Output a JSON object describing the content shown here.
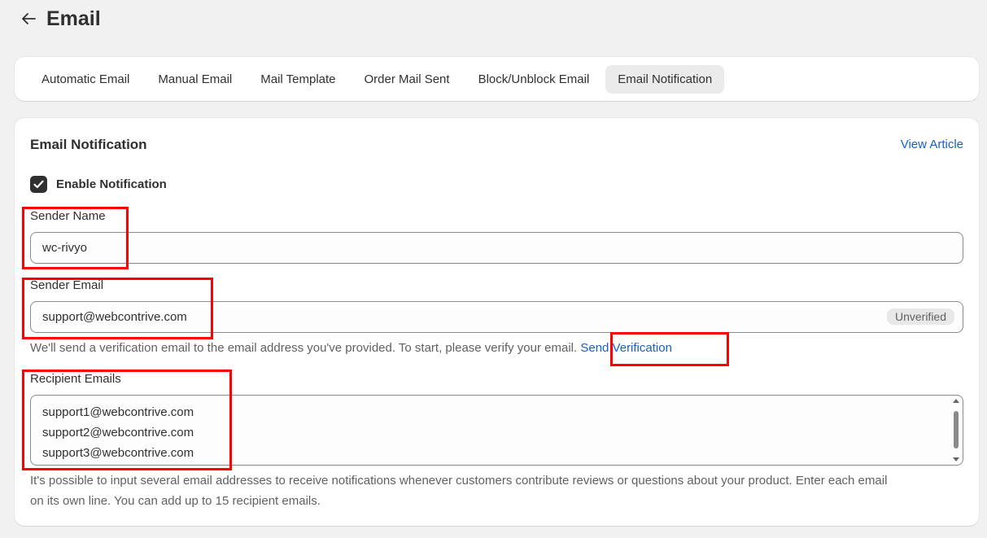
{
  "header": {
    "title": "Email"
  },
  "tabs": [
    {
      "label": "Automatic Email",
      "active": false
    },
    {
      "label": "Manual Email",
      "active": false
    },
    {
      "label": "Mail Template",
      "active": false
    },
    {
      "label": "Order Mail Sent",
      "active": false
    },
    {
      "label": "Block/Unblock Email",
      "active": false
    },
    {
      "label": "Email Notification",
      "active": true
    }
  ],
  "section": {
    "title": "Email Notification",
    "view_article": "View Article"
  },
  "enable_notification": {
    "label": "Enable Notification",
    "checked": true
  },
  "sender_name": {
    "label": "Sender Name",
    "value": "wc-rivyo"
  },
  "sender_email": {
    "label": "Sender Email",
    "value": "support@webcontrive.com",
    "badge": "Unverified",
    "help": "We'll send a verification email to the email address you've provided. To start, please verify your email.",
    "send_verification": "Send Verification"
  },
  "recipient_emails": {
    "label": "Recipient Emails",
    "values": [
      "support1@webcontrive.com",
      "support2@webcontrive.com",
      "support3@webcontrive.com"
    ],
    "help_line1": "It's possible to input several email addresses to receive notifications whenever customers contribute reviews or questions about your product. Enter each email",
    "help_line2": "on its own line. You can add up to 15 recipient emails."
  },
  "colors": {
    "accent": "#1660c5",
    "highlight": "#ff0000",
    "checkbox": "#303030"
  }
}
